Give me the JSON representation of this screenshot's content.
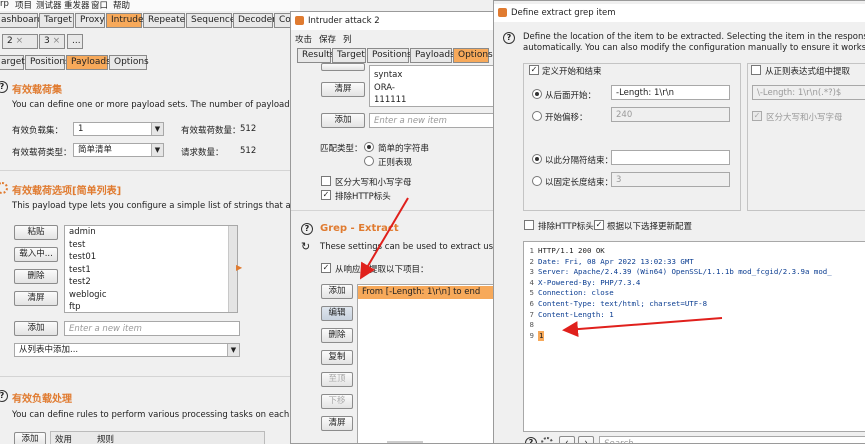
{
  "burp": {
    "menu": [
      "rp",
      "项目",
      "测试器",
      "重发器",
      "窗口",
      "帮助"
    ],
    "tabs": [
      "ashboard",
      "Target",
      "Proxy",
      "Intruder",
      "Repeater",
      "Sequencer",
      "Decoder",
      "Co"
    ],
    "attack_tabs": [
      "2",
      "3",
      "..."
    ],
    "sub_tabs": [
      "arget",
      "Positions",
      "Payloads",
      "Options"
    ],
    "payload_sets": {
      "title": "有效载荷集",
      "desc": "You can define one or more payload sets. The number of payload sets depends o",
      "set_label": "有效负载集：",
      "set_value": "1",
      "count_label": "有效载荷数量：",
      "count_value": "512",
      "type_label": "有效载荷类型：",
      "type_value": "简单清单",
      "req_label": "请求数量：",
      "req_value": "512"
    },
    "payload_options": {
      "title": "有效载荷选项[简单列表]",
      "desc": "This payload type lets you configure a simple list of strings that are used as payloa",
      "buttons": [
        "粘贴",
        "载入中...",
        "删除",
        "清屏"
      ],
      "items": [
        "admin",
        "test",
        "test01",
        "test1",
        "test2",
        "weblogic",
        "ftp"
      ],
      "add_label": "添加",
      "add_placeholder": "Enter a new item",
      "from_list": "从列表中添加..."
    },
    "payload_processing": {
      "title": "有效负载处理",
      "desc": "You can define rules to perform various processing tasks on each payload before",
      "add_label": "添加",
      "col_enabled": "效用",
      "col_rule": "规则"
    }
  },
  "intruder_attack": {
    "title": "Intruder attack 2",
    "menu": [
      "攻击",
      "保存",
      "列"
    ],
    "tabs": [
      "Results",
      "Target",
      "Positions",
      "Payloads",
      "Options"
    ],
    "list_items": [
      "syntax",
      "ORA-",
      "111111"
    ],
    "clear_label": "清屏",
    "add_label": "添加",
    "add_placeholder": "Enter a new item",
    "match_type_label": "匹配类型：",
    "match_simple": "简单的字符串",
    "match_regex": "正则表现",
    "case_sensitive": "区分大写和小写字母",
    "exclude_http": "排除HTTP标头",
    "grep_title": "Grep - Extract",
    "grep_desc": "These settings can be used to extract useful inform",
    "extract_label": "从响应中提取以下项目：",
    "grep_buttons": [
      "添加",
      "编辑",
      "删除",
      "复制",
      "至顶",
      "下移",
      "清屏"
    ],
    "grep_item": "From [-Length: 1\\r\\n] to end"
  },
  "extract_dialog": {
    "title": "Define extract grep item",
    "desc_line1": "Define the location of the item to be extracted. Selecting the item in the response panel will create a s",
    "desc_line2": "automatically. You can also modify the configuration manually to ensure it works effectively.",
    "define_start_end": "定义开始和结束",
    "start_after_label": "从后面开始：",
    "start_after_value": "-Length: 1\\r\\n",
    "start_offset_label": "开始偏移：",
    "start_offset_value": "240",
    "end_delim_label": "以此分隔符结束：",
    "end_delim_value": "",
    "end_fixed_label": "以固定长度结束：",
    "end_fixed_value": "3",
    "regex_label": "从正则表达式组中提取",
    "regex_value": "\\-Length: 1\\r\\n(.*?)$",
    "regex_case": "区分大写和小写字母",
    "exclude_http": "排除HTTP标头",
    "update_config": "根据以下选择更新配置",
    "response_lines": [
      "HTTP/1.1 200 OK",
      "Date: Fri, 08 Apr 2022 13:02:33 GMT",
      "Server: Apache/2.4.39 (Win64) OpenSSL/1.1.1b mod_fcgid/2.3.9a mod_",
      "X-Powered-By: PHP/7.3.4",
      "Connection: close",
      "Content-Type: text/html; charset=UTF-8",
      "Content-Length: 1",
      "",
      "1"
    ],
    "search_placeholder": "Search...",
    "colors": {
      "header_name": "#0b3d91",
      "accent": "#e07b30",
      "arrow": "#e0201c"
    }
  }
}
